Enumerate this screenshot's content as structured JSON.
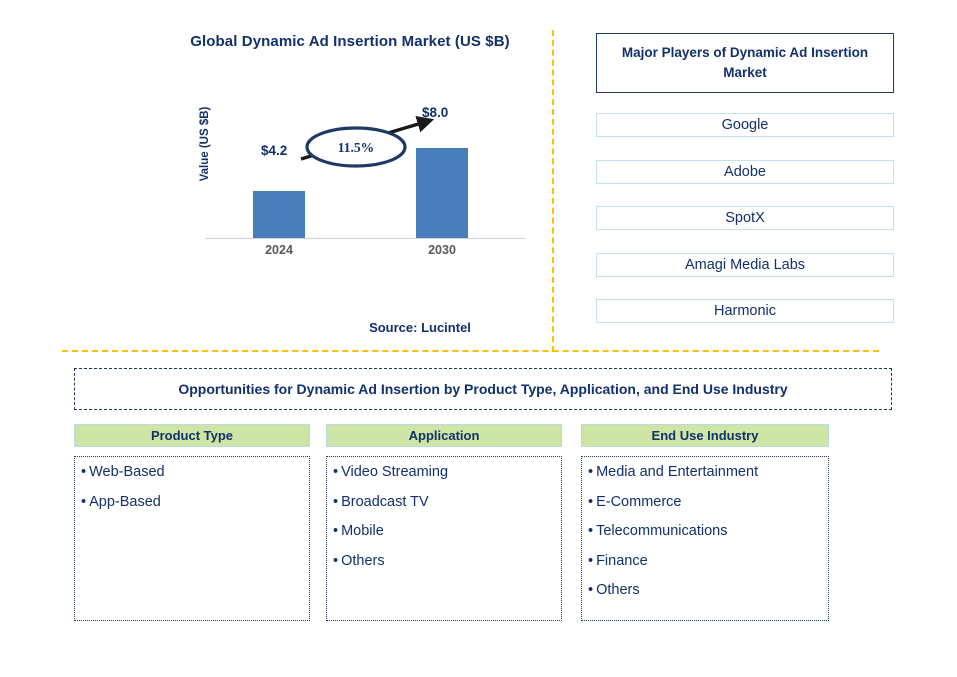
{
  "chart_data": {
    "type": "bar",
    "title": "Global Dynamic Ad Insertion Market (US $B)",
    "ylabel": "Value (US $B)",
    "xlabel": "",
    "categories": [
      "2024",
      "2030"
    ],
    "values": [
      4.2,
      8.0
    ],
    "value_labels": [
      "$4.2",
      "$8.0"
    ],
    "cagr_label": "11.5%",
    "ylim": [
      0,
      9
    ],
    "grid": false,
    "legend": "none",
    "bar_color": "#4a7ebb",
    "source": "Source: Lucintel"
  },
  "players": {
    "header": "Major Players of Dynamic Ad Insertion Market",
    "items": [
      {
        "name": "Google"
      },
      {
        "name": "Adobe"
      },
      {
        "name": "SpotX"
      },
      {
        "name": "Amagi Media Labs"
      },
      {
        "name": "Harmonic"
      }
    ]
  },
  "opportunities": {
    "banner": "Opportunities for Dynamic Ad Insertion by Product Type, Application, and End Use Industry",
    "columns": [
      {
        "header": "Product Type",
        "items": [
          "Web-Based",
          "App-Based"
        ]
      },
      {
        "header": "Application",
        "items": [
          "Video Streaming",
          "Broadcast TV",
          "Mobile",
          "Others"
        ]
      },
      {
        "header": "End Use Industry",
        "items": [
          "Media and Entertainment",
          "E-Commerce",
          "Telecommunications",
          "Finance",
          "Others"
        ]
      }
    ]
  },
  "colors": {
    "bar": "#4a7ebb",
    "navy": "#12306b",
    "divider": "#ffc000",
    "header_green": "#cde6a5",
    "box_border": "#c5dff3"
  },
  "bullet_glyph": "•"
}
